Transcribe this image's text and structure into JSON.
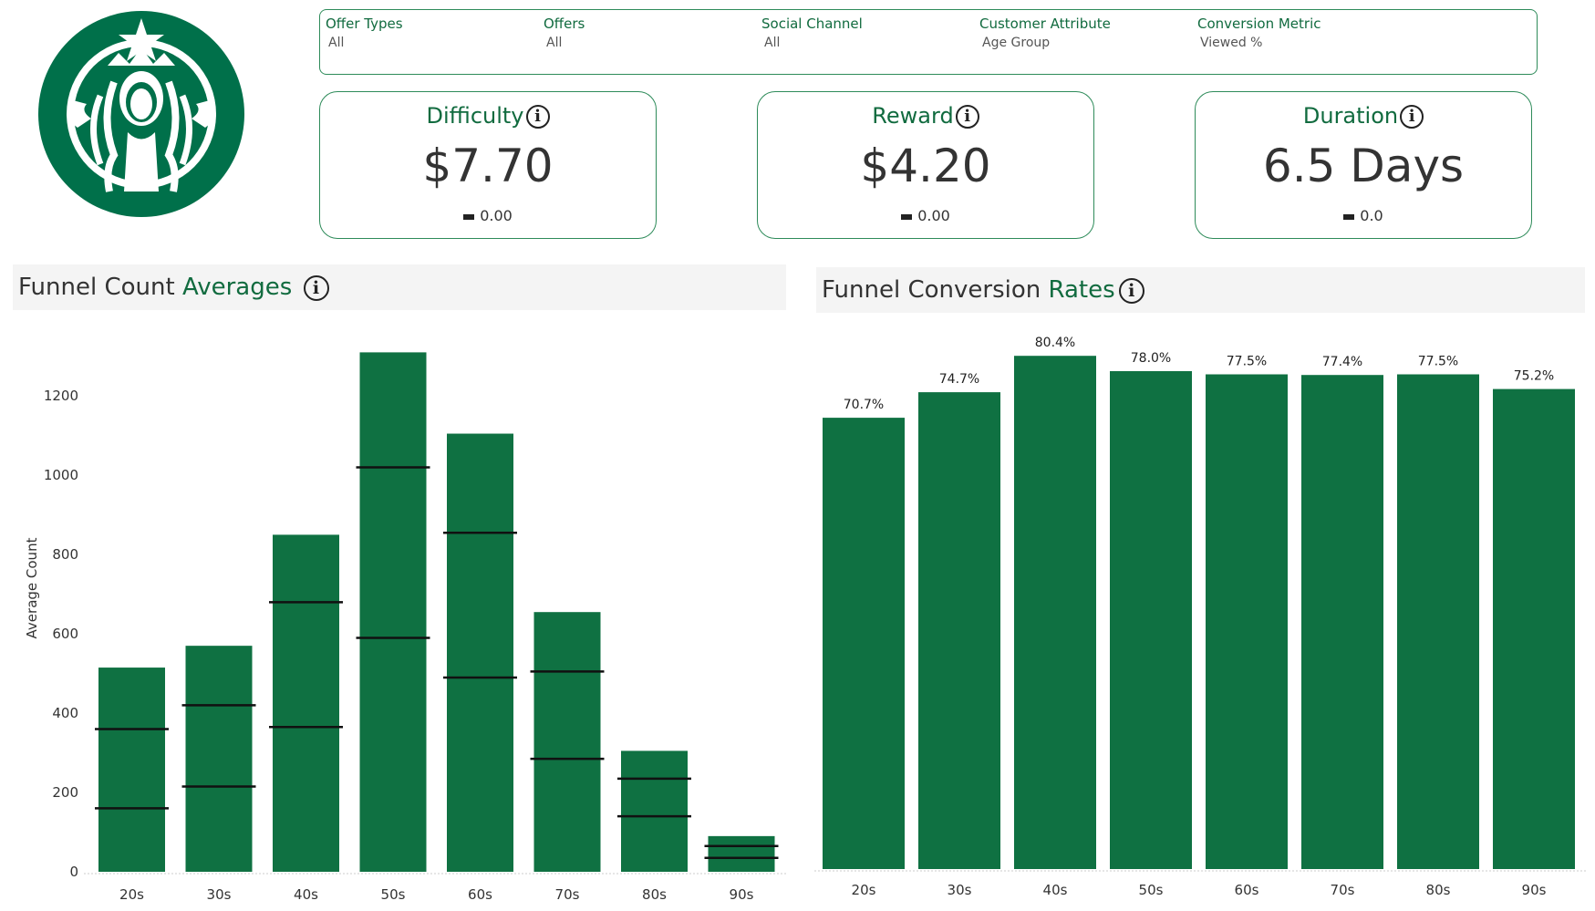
{
  "brand": {
    "logo_name": "starbucks-siren-logo",
    "color": "#00704a"
  },
  "filters": [
    {
      "label": "Offer Types",
      "value": "All"
    },
    {
      "label": "Offers",
      "value": "All"
    },
    {
      "label": "Social Channel",
      "value": "All"
    },
    {
      "label": "Customer Attribute",
      "value": "Age Group"
    },
    {
      "label": "Conversion Metric",
      "value": "Viewed %"
    }
  ],
  "kpis": [
    {
      "title": "Difficulty",
      "value": "$7.70",
      "delta": "0.00",
      "icon": "info-icon"
    },
    {
      "title": "Reward",
      "value": "$4.20",
      "delta": "0.00",
      "icon": "info-icon"
    },
    {
      "title": "Duration",
      "value": "6.5 Days",
      "delta": "0.0",
      "icon": "info-icon"
    }
  ],
  "panels": {
    "left": {
      "title_plain": "Funnel Count ",
      "title_accent": "Averages"
    },
    "right": {
      "title_plain": "Funnel Conversion ",
      "title_accent": "Rates"
    }
  },
  "colors": {
    "bar": "#0f7142",
    "accent": "#116b3f",
    "panel_bg": "#f4f4f4"
  },
  "chart_data": [
    {
      "type": "bar",
      "title": "Funnel Count Averages",
      "ylabel": "Average Count",
      "xlabel": "",
      "categories": [
        "20s",
        "30s",
        "40s",
        "50s",
        "60s",
        "70s",
        "80s",
        "90s"
      ],
      "values": [
        515,
        570,
        850,
        1310,
        1105,
        655,
        305,
        90
      ],
      "reference_lines": {
        "upper": [
          360,
          420,
          680,
          1020,
          855,
          505,
          235,
          65
        ],
        "lower": [
          160,
          215,
          365,
          590,
          490,
          285,
          140,
          35
        ]
      },
      "yticks": [
        0,
        200,
        400,
        600,
        800,
        1000,
        1200
      ],
      "ylim": [
        0,
        1350
      ],
      "grid": false
    },
    {
      "type": "bar",
      "title": "Funnel Conversion Rates",
      "categories": [
        "20s",
        "30s",
        "40s",
        "50s",
        "60s",
        "70s",
        "80s",
        "90s"
      ],
      "values": [
        70.7,
        74.7,
        80.4,
        78.0,
        77.5,
        77.4,
        77.5,
        75.2
      ],
      "labels": [
        "70.7%",
        "74.7%",
        "80.4%",
        "78.0%",
        "77.5%",
        "77.4%",
        "77.5%",
        "75.2%"
      ],
      "ylim": [
        0,
        84
      ],
      "grid": false
    }
  ]
}
